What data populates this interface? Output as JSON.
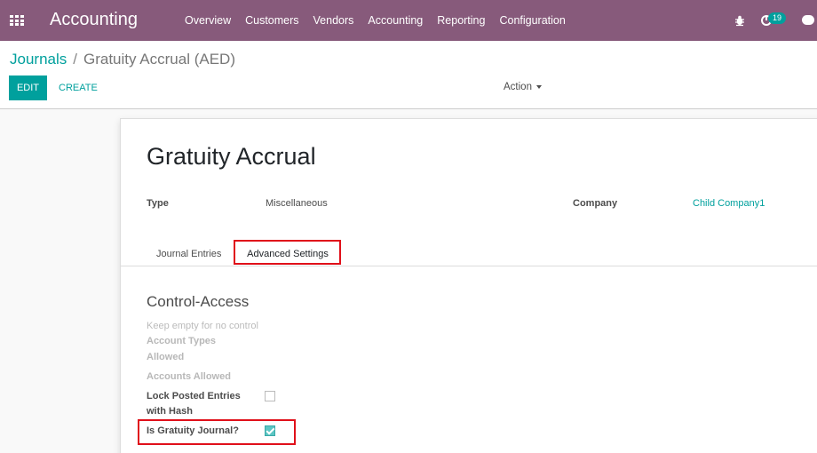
{
  "navbar": {
    "app_title": "Accounting",
    "menu": [
      "Overview",
      "Customers",
      "Vendors",
      "Accounting",
      "Reporting",
      "Configuration"
    ],
    "activity_count": "19",
    "color": "#875A7B"
  },
  "breadcrumb": {
    "parent": "Journals",
    "separator": "/",
    "current": "Gratuity Accrual (AED)"
  },
  "buttons": {
    "edit": "EDIT",
    "create": "CREATE",
    "action": "Action"
  },
  "record": {
    "title": "Gratuity Accrual",
    "type_label": "Type",
    "type_value": "Miscellaneous",
    "company_label": "Company",
    "company_value": "Child Company1"
  },
  "tabs": [
    "Journal Entries",
    "Advanced Settings"
  ],
  "control_access": {
    "title": "Control-Access",
    "placeholder": "Keep empty for no control",
    "account_types_line1": "Account Types",
    "account_types_line2": "Allowed",
    "accounts_allowed": "Accounts Allowed",
    "lock_posted_line1": "Lock Posted Entries",
    "lock_posted_line2": "with Hash",
    "lock_posted_checked": false,
    "gratuity_label": "Is Gratuity Journal?",
    "gratuity_checked": true
  },
  "colors": {
    "accent": "#00A09D",
    "highlight": "#e0101a"
  }
}
